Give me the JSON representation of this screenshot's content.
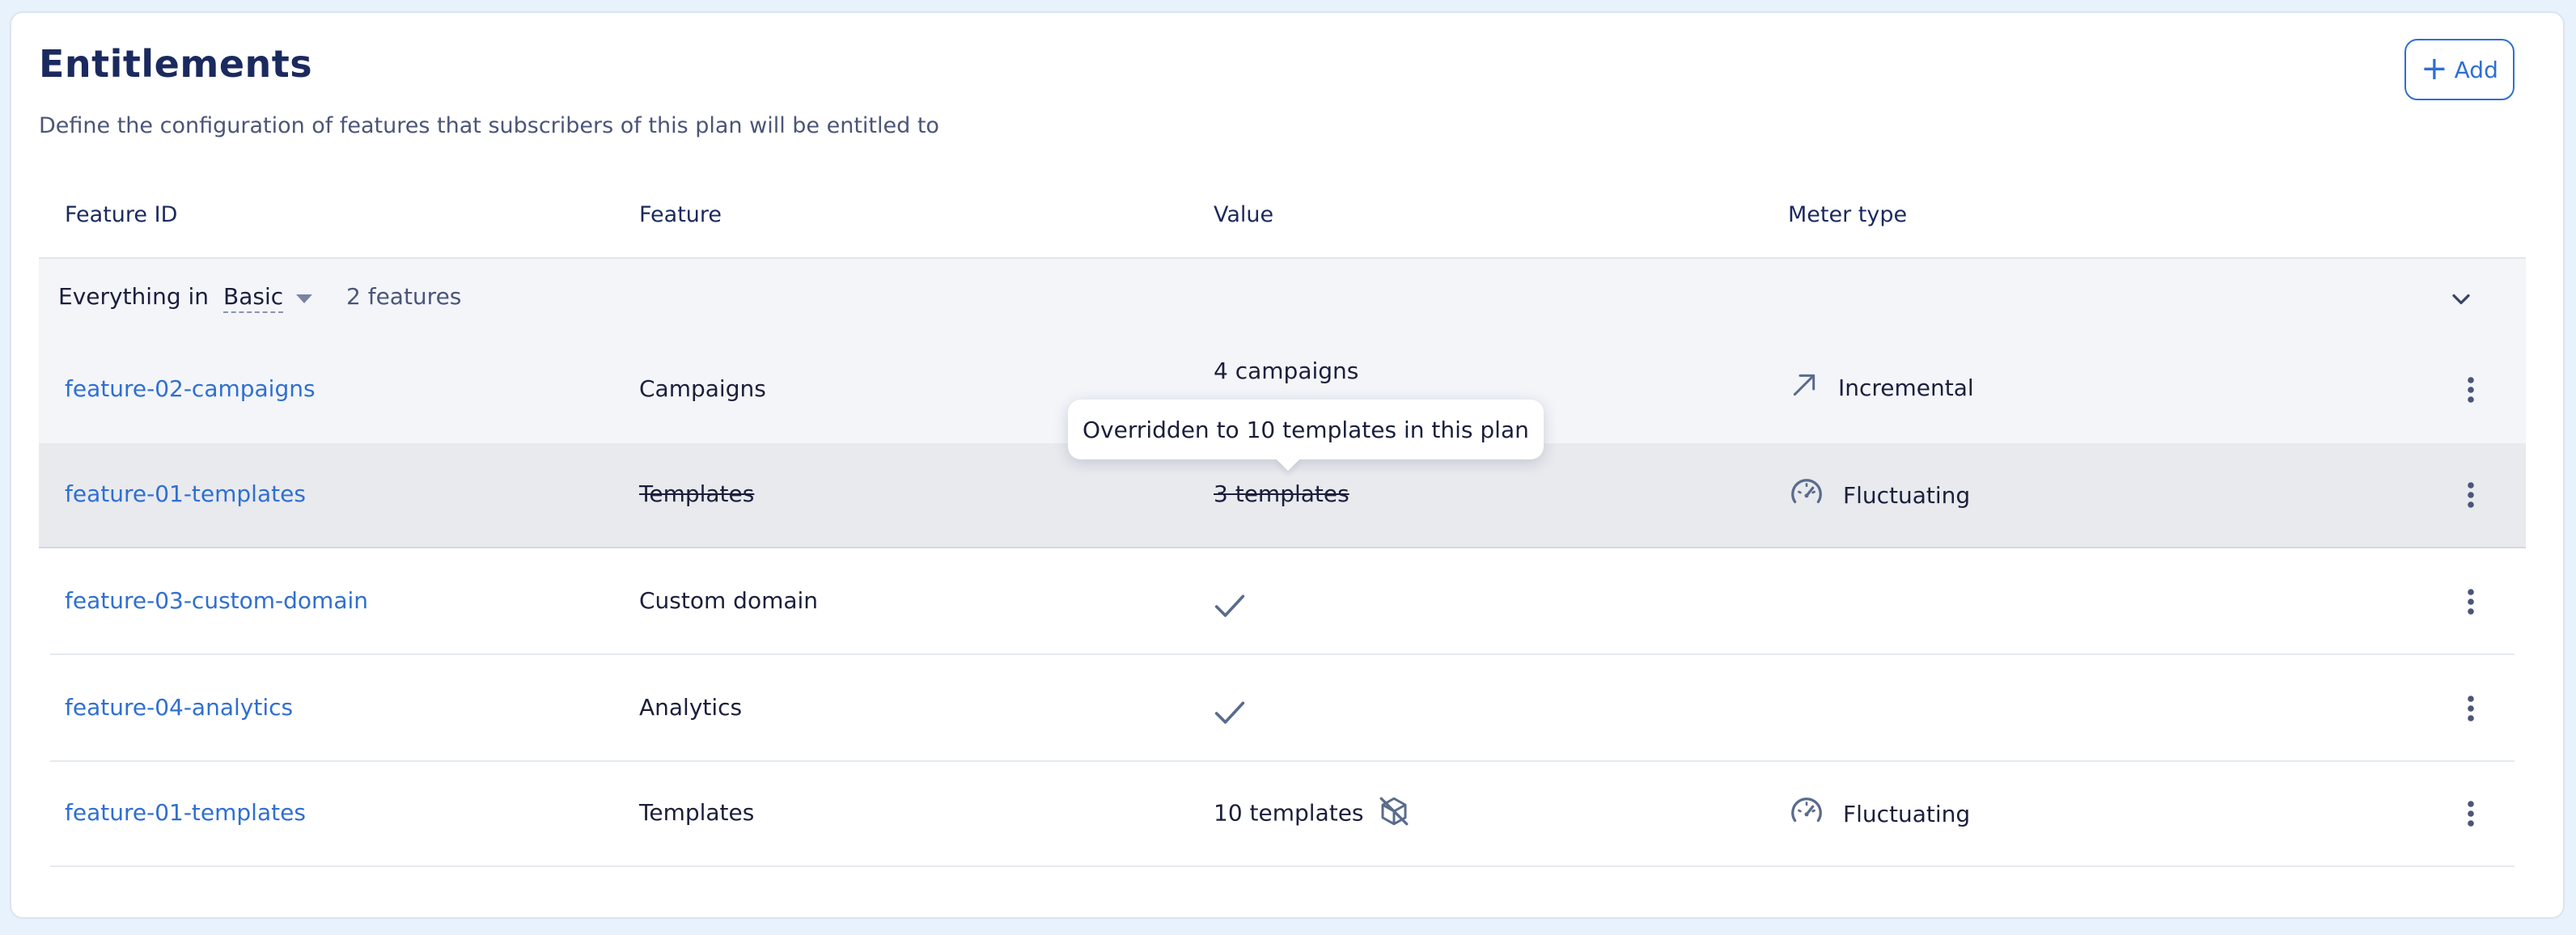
{
  "header": {
    "title": "Entitlements",
    "subtitle": "Define the configuration of features that subscribers of this plan will be entitled to",
    "add_label": "Add"
  },
  "table": {
    "columns": [
      "Feature ID",
      "Feature",
      "Value",
      "Meter type"
    ],
    "group": {
      "prefix": "Everything in",
      "plan": "Basic",
      "count": "2 features"
    },
    "rows": [
      {
        "feature_id": "feature-02-campaigns",
        "feature": "Campaigns",
        "value": "4 campaigns",
        "meter": "Incremental",
        "meter_icon": "arrow-up-right-icon",
        "inherited": true
      },
      {
        "feature_id": "feature-01-templates",
        "feature": "Templates",
        "value": "3 templates",
        "meter": "Fluctuating",
        "meter_icon": "gauge-icon",
        "inherited": true,
        "overridden": true
      },
      {
        "feature_id": "feature-03-custom-domain",
        "feature": "Custom domain",
        "value_icon": "check-icon",
        "meter": ""
      },
      {
        "feature_id": "feature-04-analytics",
        "feature": "Analytics",
        "value_icon": "check-icon",
        "meter": ""
      },
      {
        "feature_id": "feature-01-templates",
        "feature": "Templates",
        "value": "10 templates",
        "value_icon": "override-box-icon",
        "meter": "Fluctuating",
        "meter_icon": "gauge-icon"
      }
    ]
  },
  "tooltip": {
    "text": "Overridden to 10 templates in this plan"
  },
  "colors": {
    "accent": "#2f6fd1",
    "title": "#1b2a5e",
    "page_bg": "#e8f2fc",
    "group_bg": "#f3f5f9",
    "hover_row_bg": "#e8eaee"
  }
}
